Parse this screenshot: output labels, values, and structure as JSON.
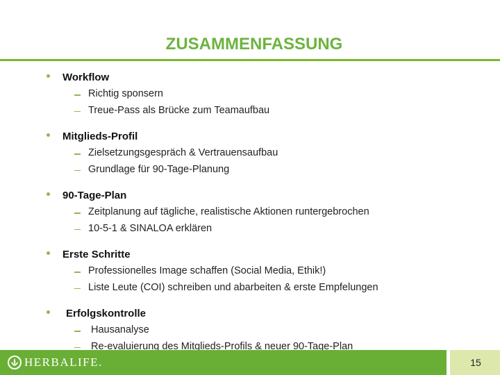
{
  "slide": {
    "title": "ZUSAMMENFASSUNG",
    "page_number": "15",
    "brand": "HERBALIFE.",
    "colors": {
      "title": "#6db33f",
      "accent_rule": "#7ab929",
      "footer": "#6aaf35",
      "page_box": "#dde8ad",
      "bullet": "#8fb65a"
    }
  },
  "sections": [
    {
      "heading": "Workflow",
      "items": [
        "Richtig sponsern",
        "Treue-Pass als Brücke zum Teamaufbau"
      ]
    },
    {
      "heading": "Mitglieds-Profil",
      "items": [
        "Zielsetzungsgespräch & Vertrauensaufbau",
        "Grundlage für 90-Tage-Planung"
      ]
    },
    {
      "heading": "90-Tage-Plan",
      "items": [
        "Zeitplanung auf tägliche, realistische Aktionen runtergebrochen",
        "10-5-1 & SINALOA erklären"
      ]
    },
    {
      "heading": "Erste Schritte",
      "items": [
        "Professionelles Image schaffen (Social Media, Ethik!)",
        "Liste Leute (COI) schreiben und abarbeiten & erste Empfelungen"
      ]
    },
    {
      "heading": "Erfolgskontrolle",
      "items": [
        "Hausanalyse",
        "Re-evaluierung des Mitglieds-Profils & neuer 90-Tage-Plan"
      ]
    }
  ]
}
